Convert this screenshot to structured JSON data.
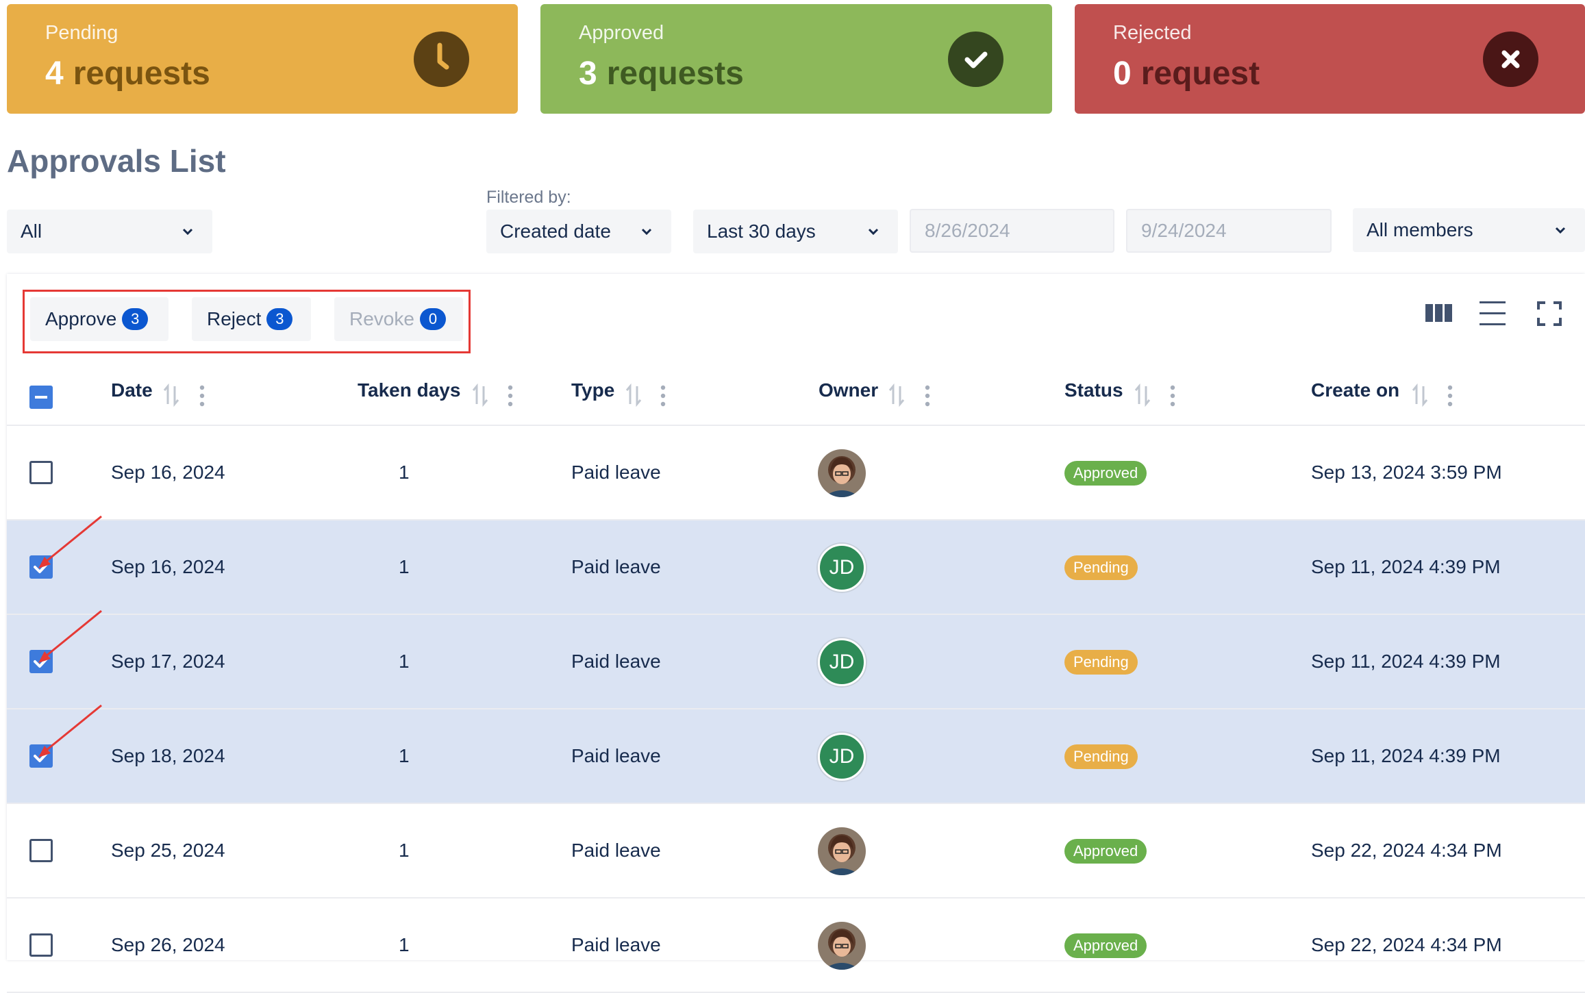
{
  "summary": {
    "pending": {
      "label": "Pending",
      "count": "4",
      "unit": "requests",
      "color": "#e8ae47",
      "icon": "clock-icon"
    },
    "approved": {
      "label": "Approved",
      "count": "3",
      "unit": "requests",
      "color": "#8db85a",
      "icon": "check-icon"
    },
    "rejected": {
      "label": "Rejected",
      "count": "0",
      "unit": "request",
      "color": "#c0504f",
      "icon": "close-icon"
    }
  },
  "page_title": "Approvals List",
  "filters": {
    "status_select": "All",
    "filtered_by_label": "Filtered by:",
    "field_select": "Created date",
    "range_select": "Last 30 days",
    "date_from": "8/26/2024",
    "date_to": "9/24/2024",
    "members_select": "All members"
  },
  "actions": {
    "approve": {
      "label": "Approve",
      "count": "3"
    },
    "reject": {
      "label": "Reject",
      "count": "3"
    },
    "revoke": {
      "label": "Revoke",
      "count": "0"
    }
  },
  "toolbar": {
    "icons": [
      "columns-icon",
      "density-icon",
      "fullscreen-icon"
    ]
  },
  "table": {
    "headers": {
      "date": "Date",
      "taken_days": "Taken days",
      "type": "Type",
      "owner": "Owner",
      "status": "Status",
      "created_on": "Create on"
    },
    "rows": [
      {
        "date": "Sep 16, 2024",
        "taken": "1",
        "type": "Paid leave",
        "owner": "photo",
        "initials": "",
        "status": "Approved",
        "created": "Sep 13, 2024 3:59 PM",
        "checked": false
      },
      {
        "date": "Sep 16, 2024",
        "taken": "1",
        "type": "Paid leave",
        "owner": "initials",
        "initials": "JD",
        "status": "Pending",
        "created": "Sep 11, 2024 4:39 PM",
        "checked": true
      },
      {
        "date": "Sep 17, 2024",
        "taken": "1",
        "type": "Paid leave",
        "owner": "initials",
        "initials": "JD",
        "status": "Pending",
        "created": "Sep 11, 2024 4:39 PM",
        "checked": true
      },
      {
        "date": "Sep 18, 2024",
        "taken": "1",
        "type": "Paid leave",
        "owner": "initials",
        "initials": "JD",
        "status": "Pending",
        "created": "Sep 11, 2024 4:39 PM",
        "checked": true
      },
      {
        "date": "Sep 25, 2024",
        "taken": "1",
        "type": "Paid leave",
        "owner": "photo",
        "initials": "",
        "status": "Approved",
        "created": "Sep 22, 2024 4:34 PM",
        "checked": false
      },
      {
        "date": "Sep 26, 2024",
        "taken": "1",
        "type": "Paid leave",
        "owner": "photo",
        "initials": "",
        "status": "Approved",
        "created": "Sep 22, 2024 4:34 PM",
        "checked": false
      }
    ]
  },
  "status_colors": {
    "Approved": "#6ab04c",
    "Pending": "#e8ae47"
  },
  "annotation_color": "#e53935"
}
